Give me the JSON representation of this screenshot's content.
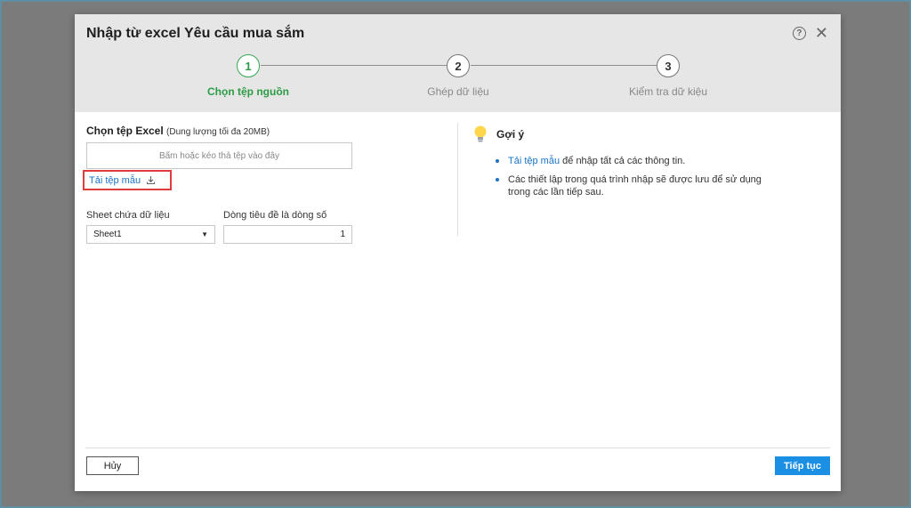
{
  "dialog": {
    "title": "Nhập từ excel Yêu cầu mua sắm"
  },
  "steps": [
    {
      "number": "1",
      "label": "Chọn tệp nguồn",
      "active": true
    },
    {
      "number": "2",
      "label": "Ghép dữ liệu",
      "active": false
    },
    {
      "number": "3",
      "label": "Kiểm tra dữ kiệu",
      "active": false
    }
  ],
  "source": {
    "title": "Chọn tệp Excel",
    "size_note": "(Dung lượng tối đa 20MB)",
    "dropzone_text": "Bấm hoặc kéo thả tệp vào đây",
    "template_link": "Tải tệp mẫu",
    "sheet_label": "Sheet chứa dữ liệu",
    "sheet_value": "Sheet1",
    "header_row_label": "Dòng tiêu đề là dòng số",
    "header_row_value": "1"
  },
  "hint": {
    "title": "Gợi ý",
    "item1_link": "Tải tệp mẫu",
    "item1_text": " để nhập tất cả các thông tin.",
    "item2_text": "Các thiết lập trong quá trình nhập sẽ được lưu để sử dụng trong các lần tiếp sau."
  },
  "footer": {
    "cancel_label": "Hủy",
    "next_label": "Tiếp tục"
  },
  "colors": {
    "accent": "#1a8fe3",
    "active_step": "#2d9b46",
    "highlight_box": "#e03c3c"
  }
}
